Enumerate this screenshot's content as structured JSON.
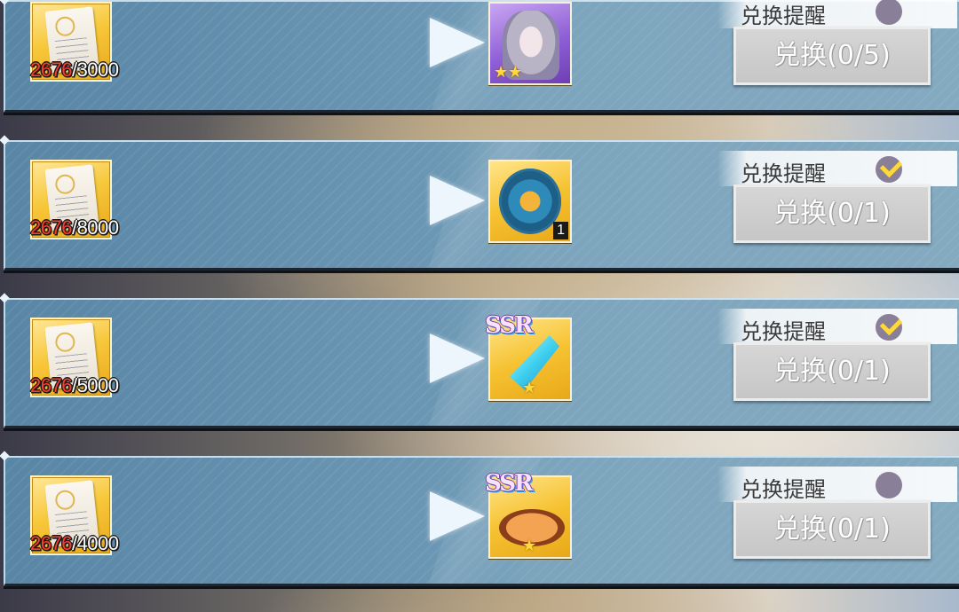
{
  "remind_label": "兑换提醒",
  "rows": [
    {
      "cost_have": "2676",
      "cost_need": "/3000",
      "reward_type": "portrait-icon",
      "reward_stars": "★★",
      "reward_qty": "",
      "ssr": "",
      "remind_on": false,
      "remind_state": "off",
      "button": "兑换(0/5)"
    },
    {
      "cost_have": "2676",
      "cost_need": "/8000",
      "reward_type": "medal-icon",
      "reward_stars": "",
      "reward_qty": "1",
      "ssr": "",
      "remind_on": true,
      "remind_state": "on",
      "button": "兑换(0/1)"
    },
    {
      "cost_have": "2676",
      "cost_need": "/5000",
      "reward_type": "sword-icon",
      "reward_stars": "★",
      "reward_qty": "",
      "ssr": "SSR",
      "remind_on": true,
      "remind_state": "on",
      "button": "兑换(0/1)"
    },
    {
      "cost_have": "2676",
      "cost_need": "/4000",
      "reward_type": "cake-icon",
      "reward_stars": "★",
      "reward_qty": "",
      "ssr": "SSR",
      "remind_on": false,
      "remind_state": "off",
      "button": "兑换(0/1)"
    }
  ]
}
